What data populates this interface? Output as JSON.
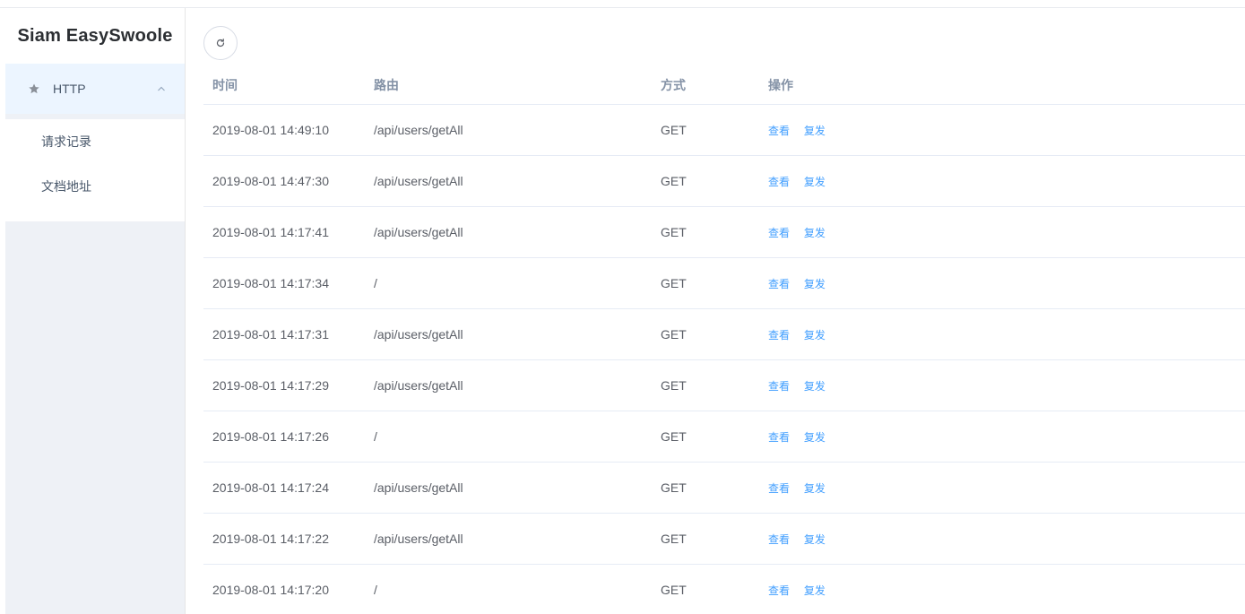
{
  "app": {
    "title": "Siam EasySwoole"
  },
  "sidebar": {
    "group": {
      "icon": "star-icon",
      "label": "HTTP",
      "expanded": true
    },
    "items": [
      {
        "label": "请求记录"
      },
      {
        "label": "文档地址"
      }
    ]
  },
  "toolbar": {
    "refresh_icon": "refresh-icon"
  },
  "table": {
    "headers": {
      "time": "时间",
      "route": "路由",
      "method": "方式",
      "ops": "操作"
    },
    "actions": {
      "view": "查看",
      "resend": "复发"
    },
    "rows": [
      {
        "time": "2019-08-01 14:49:10",
        "route": "/api/users/getAll",
        "method": "GET"
      },
      {
        "time": "2019-08-01 14:47:30",
        "route": "/api/users/getAll",
        "method": "GET"
      },
      {
        "time": "2019-08-01 14:17:41",
        "route": "/api/users/getAll",
        "method": "GET"
      },
      {
        "time": "2019-08-01 14:17:34",
        "route": "/",
        "method": "GET"
      },
      {
        "time": "2019-08-01 14:17:31",
        "route": "/api/users/getAll",
        "method": "GET"
      },
      {
        "time": "2019-08-01 14:17:29",
        "route": "/api/users/getAll",
        "method": "GET"
      },
      {
        "time": "2019-08-01 14:17:26",
        "route": "/",
        "method": "GET"
      },
      {
        "time": "2019-08-01 14:17:24",
        "route": "/api/users/getAll",
        "method": "GET"
      },
      {
        "time": "2019-08-01 14:17:22",
        "route": "/api/users/getAll",
        "method": "GET"
      },
      {
        "time": "2019-08-01 14:17:20",
        "route": "/",
        "method": "GET"
      }
    ]
  },
  "colors": {
    "accent": "#409eff",
    "sidebar_bg": "#eef1f6",
    "active_bg": "#ecf5ff"
  }
}
